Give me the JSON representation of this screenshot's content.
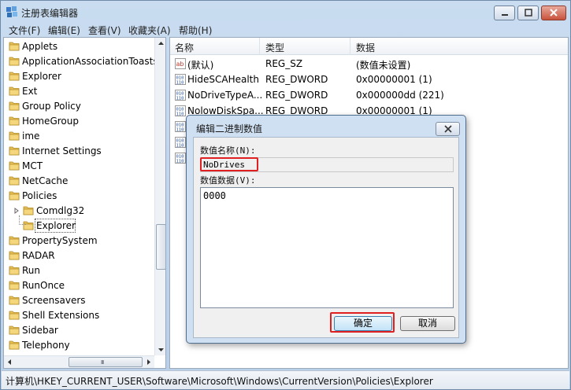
{
  "window": {
    "title": "注册表编辑器"
  },
  "menu": [
    "文件(F)",
    "编辑(E)",
    "查看(V)",
    "收藏夹(A)",
    "帮助(H)"
  ],
  "tree": {
    "items": [
      {
        "label": "Applets",
        "depth": 0
      },
      {
        "label": "ApplicationAssociationToasts",
        "depth": 0
      },
      {
        "label": "Explorer",
        "depth": 0
      },
      {
        "label": "Ext",
        "depth": 0
      },
      {
        "label": "Group Policy",
        "depth": 0
      },
      {
        "label": "HomeGroup",
        "depth": 0
      },
      {
        "label": "ime",
        "depth": 0
      },
      {
        "label": "Internet Settings",
        "depth": 0
      },
      {
        "label": "MCT",
        "depth": 0
      },
      {
        "label": "NetCache",
        "depth": 0
      },
      {
        "label": "Policies",
        "depth": 0
      },
      {
        "label": "Comdlg32",
        "depth": 1
      },
      {
        "label": "Explorer",
        "depth": 1,
        "selected": true
      },
      {
        "label": "PropertySystem",
        "depth": 0
      },
      {
        "label": "RADAR",
        "depth": 0
      },
      {
        "label": "Run",
        "depth": 0
      },
      {
        "label": "RunOnce",
        "depth": 0
      },
      {
        "label": "Screensavers",
        "depth": 0
      },
      {
        "label": "Shell Extensions",
        "depth": 0
      },
      {
        "label": "Sidebar",
        "depth": 0
      },
      {
        "label": "Telephony",
        "depth": 0
      }
    ],
    "hscroll_grip": "III"
  },
  "list": {
    "columns": [
      "名称",
      "类型",
      "数据"
    ],
    "rows": [
      {
        "icon": "string-value-icon",
        "name": "(默认)",
        "type": "REG_SZ",
        "data": "(数值未设置)"
      },
      {
        "icon": "binary-value-icon",
        "name": "HideSCAHealth",
        "type": "REG_DWORD",
        "data": "0x00000001 (1)"
      },
      {
        "icon": "binary-value-icon",
        "name": "NoDriveTypeA...",
        "type": "REG_DWORD",
        "data": "0x000000dd (221)"
      },
      {
        "icon": "binary-value-icon",
        "name": "NolowDiskSpa...",
        "type": "REG_DWORD",
        "data": "0x00000001 (1)"
      }
    ]
  },
  "status": {
    "path": "计算机\\HKEY_CURRENT_USER\\Software\\Microsoft\\Windows\\CurrentVersion\\Policies\\Explorer"
  },
  "dialog": {
    "title": "编辑二进制数值",
    "name_label": "数值名称(N):",
    "name_value": "NoDrives",
    "data_label": "数值数据(V):",
    "data_value": "0000",
    "ok_label": "确定",
    "cancel_label": "取消",
    "highlight_color": "#e02020"
  }
}
